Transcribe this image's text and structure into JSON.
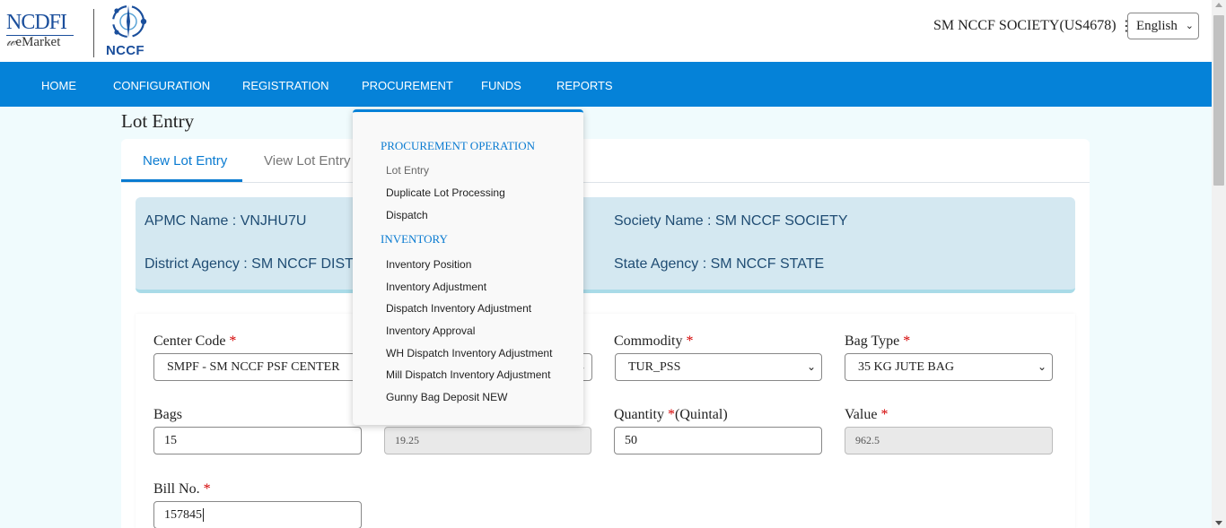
{
  "header": {
    "logo_ncdfi_title": "NCDFI",
    "logo_ncdfi_sub": "eMarket",
    "logo_nccf_text": "NCCF",
    "user_name": "SM NCCF SOCIETY(US4678)",
    "kebab": "⋮",
    "language": "English"
  },
  "nav": {
    "items": [
      "HOME",
      "CONFIGURATION",
      "REGISTRATION",
      "PROCUREMENT",
      "FUNDS",
      "REPORTS"
    ]
  },
  "page": {
    "title": "Lot Entry",
    "tabs": [
      "New Lot Entry",
      "View Lot Entry"
    ]
  },
  "info": {
    "apmc": "APMC Name : VNJHU7U",
    "district": "District Agency : SM NCCF DISTR",
    "society": "Society Name : SM NCCF SOCIETY",
    "state": "State Agency : SM NCCF STATE"
  },
  "form": {
    "center_code_label": "Center Code",
    "center_code_value": "SMPF - SM NCCF PSF CENTER",
    "commodity_label": "Commodity",
    "commodity_value": "TUR_PSS",
    "bag_type_label": "Bag Type",
    "bag_type_value": "35 KG JUTE BAG",
    "bags_label": "Bags",
    "bags_value": "15",
    "readonly_value": "19.25",
    "quantity_label": "Quantity",
    "quantity_unit": "(Quintal)",
    "quantity_value": "50",
    "value_label": "Value",
    "value_value": "962.5",
    "bill_label": "Bill No.",
    "bill_value": "157845",
    "required_mark": "*"
  },
  "dropdown": {
    "heading1": "PROCUREMENT OPERATION",
    "items1": [
      "Lot Entry",
      "Duplicate Lot Processing",
      "Dispatch"
    ],
    "heading2": "INVENTORY",
    "items2": [
      "Inventory Position",
      "Inventory Adjustment",
      "Dispatch Inventory Adjustment",
      "Inventory Approval",
      "WH Dispatch Inventory Adjustment",
      "Mill Dispatch Inventory Adjustment",
      "Gunny Bag Deposit NEW"
    ]
  },
  "colors": {
    "nav_bg": "#0582d8",
    "accent": "#0a7bd1",
    "info_bg": "#d4e8f1",
    "required": "#d40000"
  }
}
